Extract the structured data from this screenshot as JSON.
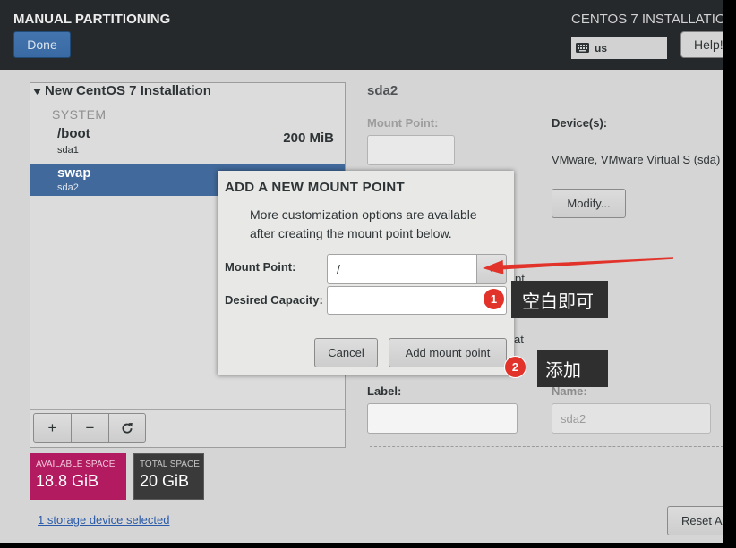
{
  "header": {
    "title": "MANUAL PARTITIONING",
    "done_label": "Done",
    "product_title": "CENTOS 7 INSTALLATIO",
    "keyboard_layout": "us",
    "help_label": "Help!"
  },
  "left_panel": {
    "installation_title": "New CentOS 7 Installation",
    "section_label": "SYSTEM",
    "partitions": [
      {
        "mount": "/boot",
        "device": "sda1",
        "size": "200 MiB",
        "selected": false
      },
      {
        "mount": "swap",
        "device": "sda2",
        "selected": true
      }
    ],
    "toolbar": {
      "add_label": "+",
      "remove_label": "−"
    }
  },
  "space": {
    "available_label": "AVAILABLE SPACE",
    "available_value": "18.8 GiB",
    "total_label": "TOTAL SPACE",
    "total_value": "20 GiB"
  },
  "storage_link": "1 storage device selected",
  "right_panel": {
    "partition_name": "sda2",
    "mount_point_label": "Mount Point:",
    "devices_label": "Device(s):",
    "devices_value": "VMware, VMware Virtual S (sda)",
    "modify_label": "Modify...",
    "obscured_label_fragments": [
      "pt",
      "at"
    ],
    "label_label": "Label:",
    "name_label": "Name:",
    "name_value": "sda2",
    "reset_label": "Reset Al"
  },
  "dialog": {
    "title": "ADD A NEW MOUNT POINT",
    "description_line1": "More customization options are available",
    "description_line2": "after creating the mount point below.",
    "mount_point_label": "Mount Point:",
    "mount_point_value": "/",
    "desired_capacity_label": "Desired Capacity:",
    "cancel_label": "Cancel",
    "add_label": "Add mount point"
  },
  "annotations": [
    {
      "number": "1",
      "text": "空白即可"
    },
    {
      "number": "2",
      "text": "添加"
    }
  ],
  "icons": {
    "expander": "expander-arrow-icon",
    "keyboard": "keyboard-icon",
    "refresh": "refresh-icon",
    "combo_dropdown": "chevron-down-icon"
  },
  "colors": {
    "header_bg": "#25292b",
    "body_bg": "#d5d5d5",
    "panel_bg": "#dcdcdc",
    "selected_row": "#42699b",
    "available_space": "#b21b60",
    "total_space": "#3a3a3a",
    "done_button": "#3a6aa4",
    "link": "#2a5aa8",
    "dialog_bg": "#e8e8e7",
    "annotation_red": "#e2332b",
    "annotation_box": "#2f2f2f"
  }
}
